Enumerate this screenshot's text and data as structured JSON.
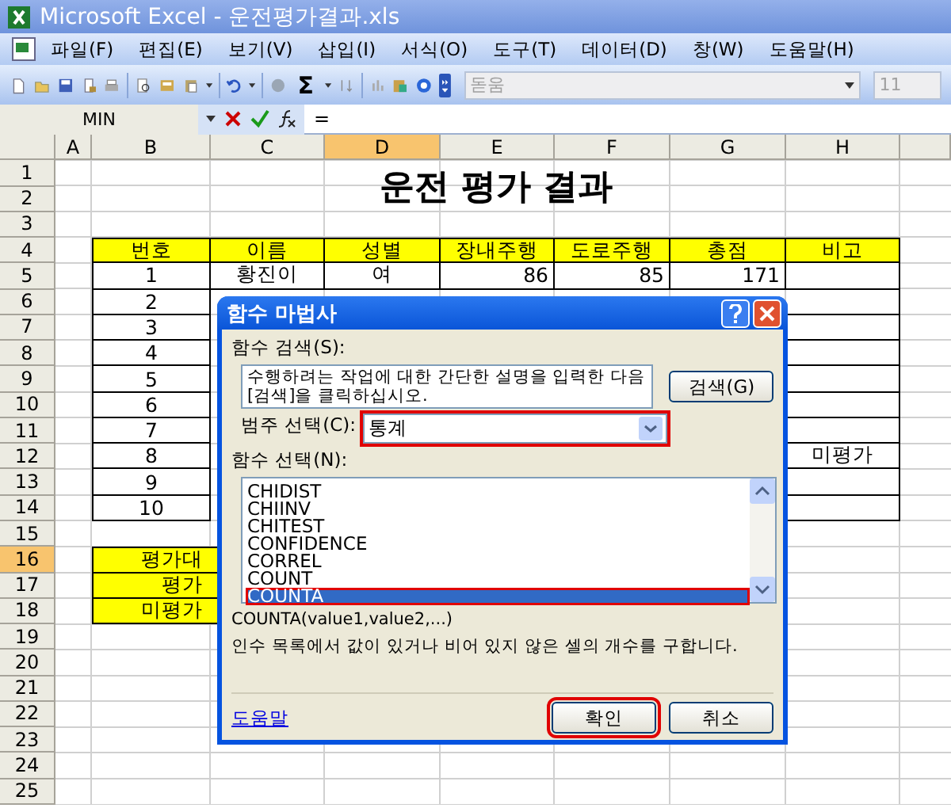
{
  "window": {
    "title": "Microsoft Excel - 운전평가결과.xls"
  },
  "menu": [
    "파일(F)",
    "편집(E)",
    "보기(V)",
    "삽입(I)",
    "서식(O)",
    "도구(T)",
    "데이터(D)",
    "창(W)",
    "도움말(H)"
  ],
  "toolbar": {
    "autosum": "Σ",
    "font": "돋움",
    "font_size": "11"
  },
  "formula_bar": {
    "name_box": "MIN",
    "formula": "="
  },
  "sheet": {
    "columns": [
      {
        "label": "A",
        "selected": false
      },
      {
        "label": "B",
        "selected": false
      },
      {
        "label": "C",
        "selected": false
      },
      {
        "label": "D",
        "selected": true
      },
      {
        "label": "E",
        "selected": false
      },
      {
        "label": "F",
        "selected": false
      },
      {
        "label": "G",
        "selected": false
      },
      {
        "label": "H",
        "selected": false
      }
    ],
    "rows": [
      {
        "number": "1",
        "selected": false,
        "kind": "title",
        "cells": {
          "B": "운전 평가 결과"
        }
      },
      {
        "number": "2",
        "selected": false,
        "kind": "empty",
        "cells": {}
      },
      {
        "number": "3",
        "selected": false,
        "kind": "empty",
        "cells": {}
      },
      {
        "number": "4",
        "selected": false,
        "kind": "header",
        "cells": {
          "B": "번호",
          "C": "이름",
          "D": "성별",
          "E": "장내주행",
          "F": "도로주행",
          "G": "총점",
          "H": "비고"
        }
      },
      {
        "number": "5",
        "selected": false,
        "kind": "data",
        "cells": {
          "B": "1",
          "C": "황진이",
          "D": "여",
          "E": "86",
          "F": "85",
          "G": "171"
        }
      },
      {
        "number": "6",
        "selected": false,
        "kind": "data",
        "cells": {
          "B": "2"
        }
      },
      {
        "number": "7",
        "selected": false,
        "kind": "data",
        "cells": {
          "B": "3"
        }
      },
      {
        "number": "8",
        "selected": false,
        "kind": "data",
        "cells": {
          "B": "4"
        }
      },
      {
        "number": "9",
        "selected": false,
        "kind": "data",
        "cells": {
          "B": "5"
        }
      },
      {
        "number": "10",
        "selected": false,
        "kind": "data",
        "cells": {
          "B": "6"
        }
      },
      {
        "number": "11",
        "selected": false,
        "kind": "data",
        "cells": {
          "B": "7"
        }
      },
      {
        "number": "12",
        "selected": false,
        "kind": "data",
        "cells": {
          "B": "8",
          "H": "미평가"
        }
      },
      {
        "number": "13",
        "selected": false,
        "kind": "data",
        "cells": {
          "B": "9"
        }
      },
      {
        "number": "14",
        "selected": false,
        "kind": "data",
        "cells": {
          "B": "10"
        }
      },
      {
        "number": "15",
        "selected": false,
        "kind": "empty",
        "cells": {}
      },
      {
        "number": "16",
        "selected": true,
        "kind": "summary",
        "cells": {
          "B": "평가대"
        }
      },
      {
        "number": "17",
        "selected": false,
        "kind": "summary",
        "cells": {
          "B": "평가"
        }
      },
      {
        "number": "18",
        "selected": false,
        "kind": "summary",
        "cells": {
          "B": "미평가"
        }
      },
      {
        "number": "19",
        "selected": false,
        "kind": "empty",
        "cells": {}
      },
      {
        "number": "20",
        "selected": false,
        "kind": "empty",
        "cells": {}
      },
      {
        "number": "21",
        "selected": false,
        "kind": "empty",
        "cells": {}
      },
      {
        "number": "22",
        "selected": false,
        "kind": "empty",
        "cells": {}
      },
      {
        "number": "23",
        "selected": false,
        "kind": "empty",
        "cells": {}
      },
      {
        "number": "24",
        "selected": false,
        "kind": "empty",
        "cells": {}
      },
      {
        "number": "25",
        "selected": false,
        "kind": "empty",
        "cells": {}
      }
    ]
  },
  "dialog": {
    "title": "함수 마법사",
    "search_label": "함수 검색(S):",
    "search_value": "수행하려는 작업에 대한 간단한 설명을 입력한 다음 [검색]을 클릭하십시오.",
    "search_button": "검색(G)",
    "category_label": "범주 선택(C):",
    "category": {
      "value": "통계",
      "highlighted": true
    },
    "function_label": "함수 선택(N):",
    "functions": [
      {
        "name": "CHIDIST",
        "selected": false,
        "highlighted": false
      },
      {
        "name": "CHIINV",
        "selected": false,
        "highlighted": false
      },
      {
        "name": "CHITEST",
        "selected": false,
        "highlighted": false
      },
      {
        "name": "CONFIDENCE",
        "selected": false,
        "highlighted": false
      },
      {
        "name": "CORREL",
        "selected": false,
        "highlighted": false
      },
      {
        "name": "COUNT",
        "selected": false,
        "highlighted": false
      },
      {
        "name": "COUNTA",
        "selected": true,
        "highlighted": true
      }
    ],
    "signature": "COUNTA(value1,value2,...)",
    "description": "인수 목록에서 값이 있거나 비어 있지 않은 셀의 개수를 구합니다.",
    "help_link": "도움말",
    "buttons": [
      {
        "label": "확인",
        "highlighted": true
      },
      {
        "label": "취소",
        "highlighted": false
      }
    ]
  }
}
